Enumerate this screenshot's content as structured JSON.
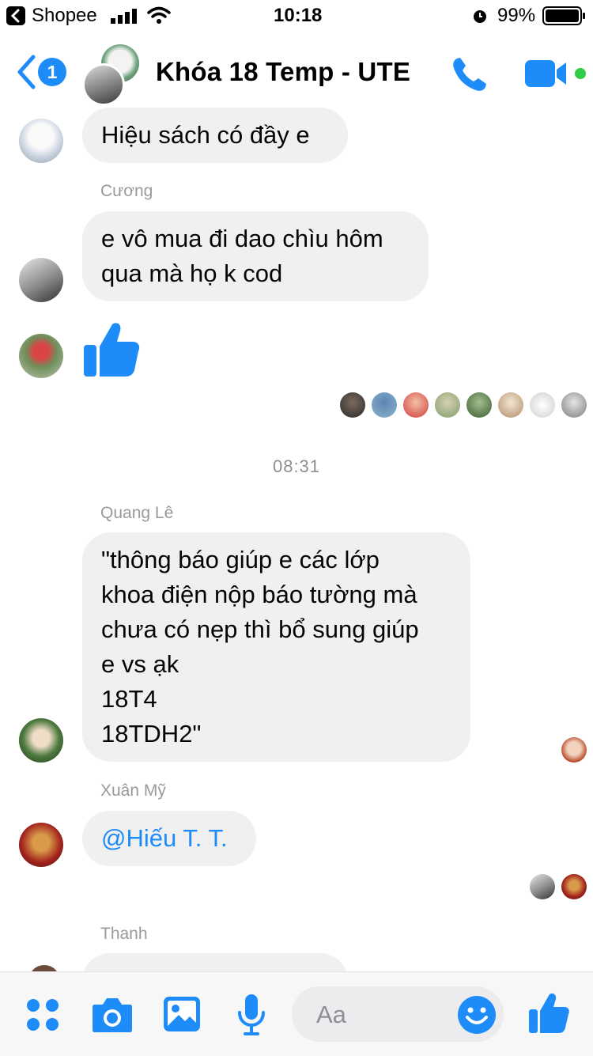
{
  "status_bar": {
    "carrier": "Shopee",
    "time": "10:18",
    "battery": "99%"
  },
  "header": {
    "unread_count": "1",
    "title": "Khóa 18 Temp - UTE"
  },
  "messages": [
    {
      "sender": "",
      "text": "Hiệu sách có đầy e"
    },
    {
      "sender": "Cương",
      "text": "e vô mua đi dao chìu hôm\nqua mà họ k cod"
    },
    {
      "sender": "",
      "text": "thumbs-up"
    }
  ],
  "timestamp": "08:31",
  "messages_after": [
    {
      "sender": "Quang Lê",
      "text": "\"thông báo giúp e các lớp\nkhoa điện nộp báo tường mà\nchưa có nẹp thì bổ sung giúp\ne vs ạk\n18T4\n18TDH2\""
    },
    {
      "sender": "Xuân Mỹ",
      "text": "@Hiếu T. T."
    },
    {
      "sender": "Thanh",
      "text": ""
    }
  ],
  "composer": {
    "placeholder": "Aa"
  },
  "colors": {
    "accent": "#1d8cf8",
    "bubble": "#f0f0f0",
    "online": "#31cc46"
  },
  "icons": [
    "back-chevron-icon",
    "phone-icon",
    "video-icon",
    "thumbs-up-icon",
    "apps-icon",
    "camera-icon",
    "image-icon",
    "microphone-icon",
    "emoji-icon"
  ]
}
